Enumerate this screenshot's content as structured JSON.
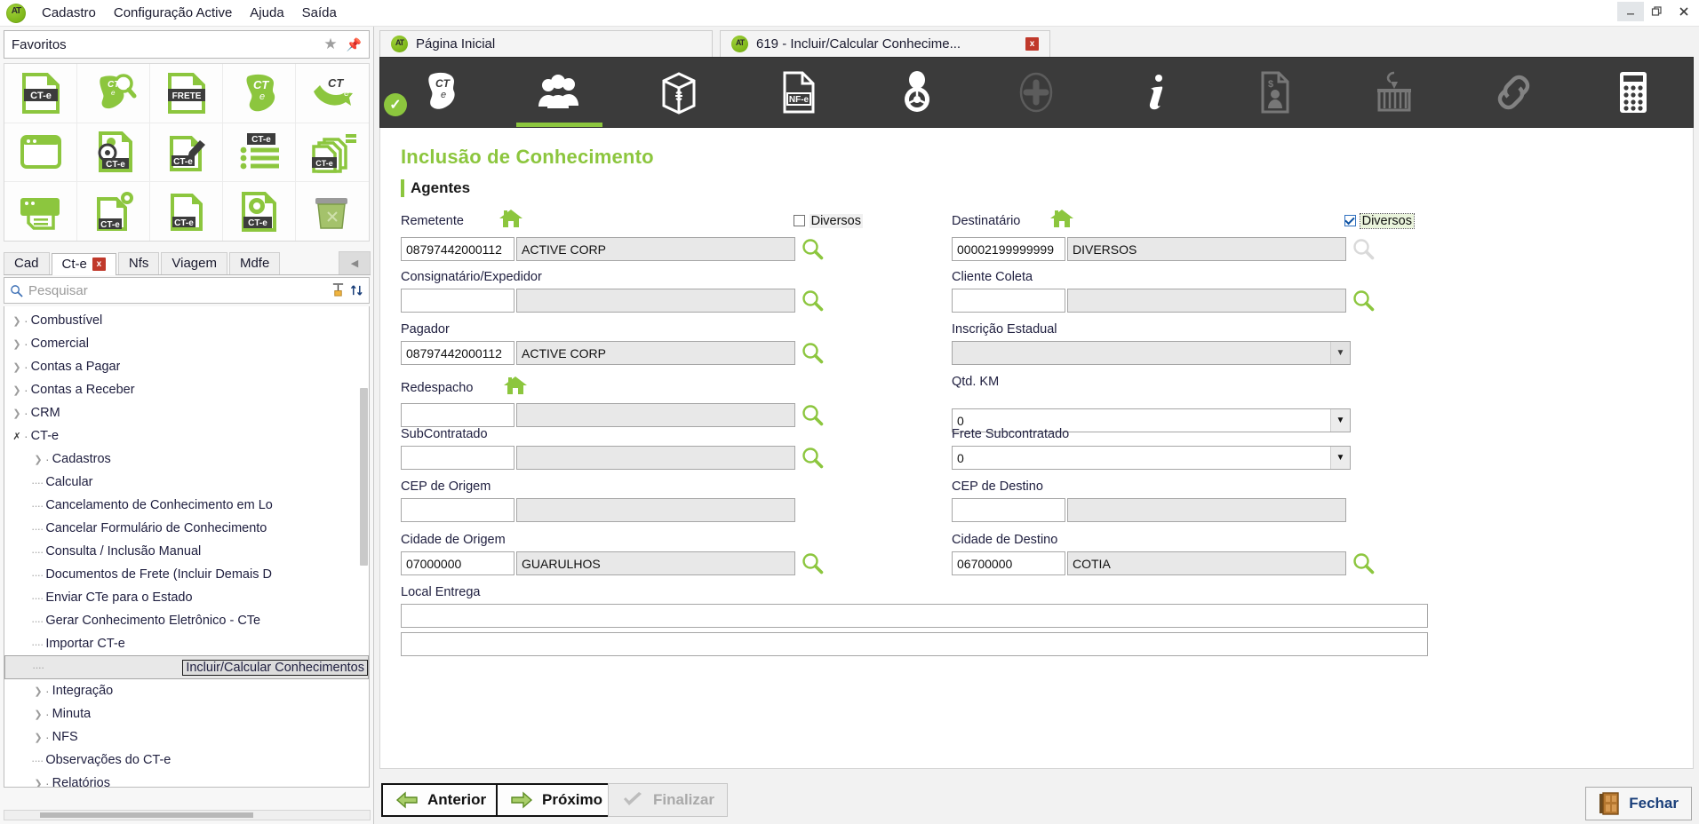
{
  "window": {
    "menu": [
      "Cadastro",
      "Configuração Active",
      "Ajuda",
      "Saída"
    ],
    "controls": {
      "minimize": "minimize-icon",
      "restore": "restore-icon",
      "close": "close-icon"
    },
    "logo_text": "AT"
  },
  "favorites": {
    "title": "Favoritos",
    "star_icon": "star-icon",
    "pin_icon": "pin-icon",
    "items": [
      {
        "name": "cte-document-icon",
        "badge": "CT-e"
      },
      {
        "name": "cte-search-map-icon",
        "badge": "CT"
      },
      {
        "name": "frete-document-icon",
        "badge": "FRETE"
      },
      {
        "name": "cte-map-icon",
        "badge": "CT"
      },
      {
        "name": "cte-arrow-icon",
        "badge": "CT"
      },
      {
        "name": "window-icon",
        "badge": ""
      },
      {
        "name": "cte-driver-document-icon",
        "badge": "CT-e"
      },
      {
        "name": "cte-edit-icon",
        "badge": "CT-e"
      },
      {
        "name": "cte-list-icon",
        "badge": "CT-e"
      },
      {
        "name": "cte-stack-icon",
        "badge": "CT-e"
      },
      {
        "name": "printer-icon",
        "badge": ""
      },
      {
        "name": "cte-gear-document-icon",
        "badge": "CT-e"
      },
      {
        "name": "cte-blank-document-icon",
        "badge": "CT-e"
      },
      {
        "name": "cte-settings-document-icon",
        "badge": "CT-e"
      },
      {
        "name": "trash-icon",
        "badge": ""
      }
    ]
  },
  "sidebar": {
    "tabs": [
      {
        "label": "Cad",
        "active": false,
        "closable": false
      },
      {
        "label": "Ct-e",
        "active": true,
        "closable": true,
        "close_label": "x"
      },
      {
        "label": "Nfs",
        "active": false,
        "closable": false
      },
      {
        "label": "Viagem",
        "active": false,
        "closable": false
      },
      {
        "label": "Mdfe",
        "active": false,
        "closable": false
      }
    ],
    "tab_overflow_icon": "chevron-left-icon",
    "search": {
      "placeholder": "Pesquisar",
      "icon": "search-icon",
      "clear_icon": "clear-filter-icon",
      "sort_icon": "sort-icon"
    },
    "tree": [
      {
        "label": "Combustível",
        "level": 1,
        "expander": "collapsed"
      },
      {
        "label": "Comercial",
        "level": 1,
        "expander": "collapsed"
      },
      {
        "label": "Contas a Pagar",
        "level": 1,
        "expander": "collapsed"
      },
      {
        "label": "Contas a Receber",
        "level": 1,
        "expander": "collapsed"
      },
      {
        "label": "CRM",
        "level": 1,
        "expander": "collapsed"
      },
      {
        "label": "CT-e",
        "level": 1,
        "expander": "expanded"
      },
      {
        "label": "Cadastros",
        "level": 2,
        "expander": "collapsed"
      },
      {
        "label": "Calcular",
        "level": 2,
        "expander": "leaf"
      },
      {
        "label": "Cancelamento de Conhecimento em Lo",
        "level": 2,
        "expander": "leaf"
      },
      {
        "label": "Cancelar Formulário de Conhecimento",
        "level": 2,
        "expander": "leaf"
      },
      {
        "label": "Consulta / Inclusão Manual",
        "level": 2,
        "expander": "leaf"
      },
      {
        "label": "Documentos de Frete (Incluir Demais D",
        "level": 2,
        "expander": "leaf"
      },
      {
        "label": "Enviar CTe para o Estado",
        "level": 2,
        "expander": "leaf"
      },
      {
        "label": "Gerar Conhecimento Eletrônico - CTe",
        "level": 2,
        "expander": "leaf"
      },
      {
        "label": "Importar CT-e",
        "level": 2,
        "expander": "leaf"
      },
      {
        "label": "Incluir/Calcular Conhecimentos",
        "level": 2,
        "expander": "leaf",
        "selected": true
      },
      {
        "label": "Integração",
        "level": 1,
        "expander": "collapsed"
      },
      {
        "label": "Minuta",
        "level": 1,
        "expander": "collapsed"
      },
      {
        "label": "NFS",
        "level": 1,
        "expander": "collapsed"
      },
      {
        "label": "Observações do CT-e",
        "level": 1,
        "expander": "leaf"
      },
      {
        "label": "Relatórios",
        "level": 1,
        "expander": "collapsed"
      }
    ]
  },
  "top_tabs": [
    {
      "label": "Página Inicial",
      "active": false,
      "closable": false
    },
    {
      "label": "619 - Incluir/Calcular Conhecime...",
      "active": true,
      "closable": true,
      "close_label": "x"
    }
  ],
  "icon_bar": [
    {
      "name": "cte-map-icon",
      "active": false,
      "badge": "check-badge-icon"
    },
    {
      "name": "people-icon",
      "active": true
    },
    {
      "name": "box-icon",
      "active": false
    },
    {
      "name": "nfe-document-icon",
      "active": false
    },
    {
      "name": "driver-icon",
      "active": false
    },
    {
      "name": "plus-circle-icon",
      "active": false,
      "disabled": true
    },
    {
      "name": "info-icon",
      "active": false
    },
    {
      "name": "money-document-icon",
      "active": false,
      "disabled": true
    },
    {
      "name": "container-icon",
      "active": false,
      "disabled": true
    },
    {
      "name": "link-icon",
      "active": false,
      "disabled": true
    },
    {
      "name": "calculator-icon",
      "active": false
    }
  ],
  "page": {
    "title": "Inclusão de Conhecimento",
    "section_title": "Agentes"
  },
  "form": {
    "remetente": {
      "label": "Remetente",
      "home_icon": "home-icon",
      "code": "08797442000112",
      "name": "ACTIVE CORP",
      "search_icon": "magnifier-icon",
      "checkbox": {
        "label": "Diversos",
        "checked": false
      }
    },
    "destinatario": {
      "label": "Destinatário",
      "home_icon": "home-icon",
      "code": "00002199999999",
      "name": "DIVERSOS",
      "search_icon": "magnifier-icon",
      "checkbox": {
        "label": "Diversos",
        "checked": true
      }
    },
    "consignatario": {
      "label": "Consignatário/Expedidor",
      "code": "",
      "name": "",
      "search_icon": "magnifier-icon"
    },
    "cliente_coleta": {
      "label": "Cliente Coleta",
      "code": "",
      "name": "",
      "search_icon": "magnifier-icon"
    },
    "pagador": {
      "label": "Pagador",
      "code": "08797442000112",
      "name": "ACTIVE CORP",
      "search_icon": "magnifier-icon"
    },
    "inscricao_estadual": {
      "label": "Inscrição Estadual",
      "value": "",
      "dropdown_icon": "chevron-down-icon"
    },
    "redespacho": {
      "label": "Redespacho",
      "home_icon": "home-icon",
      "code": "",
      "name": "",
      "search_icon": "magnifier-icon"
    },
    "qtd_km": {
      "label": "Qtd. KM",
      "value": "0",
      "dropdown_icon": "chevron-down-icon"
    },
    "subcontratado": {
      "label": "SubContratado",
      "code": "",
      "name": "",
      "search_icon": "magnifier-icon"
    },
    "frete_subcontratado": {
      "label": "Frete Subcontratado",
      "value": "0",
      "dropdown_icon": "chevron-down-icon"
    },
    "cep_origem": {
      "label": "CEP de Origem",
      "code": "",
      "name": ""
    },
    "cep_destino": {
      "label": "CEP de Destino",
      "code": "",
      "name": ""
    },
    "cidade_origem": {
      "label": "Cidade de Origem",
      "code": "07000000",
      "name": "GUARULHOS",
      "search_icon": "magnifier-icon"
    },
    "cidade_destino": {
      "label": "Cidade de Destino",
      "code": "06700000",
      "name": "COTIA",
      "search_icon": "magnifier-icon"
    },
    "local_entrega": {
      "label": "Local Entrega",
      "line1": "",
      "line2": ""
    }
  },
  "footer": {
    "previous": {
      "label": "Anterior",
      "icon": "arrow-left-icon"
    },
    "next": {
      "label": "Próximo",
      "icon": "arrow-right-icon"
    },
    "finish": {
      "label": "Finalizar",
      "icon": "check-icon",
      "disabled": true
    },
    "close": {
      "label": "Fechar",
      "icon": "door-icon"
    }
  }
}
